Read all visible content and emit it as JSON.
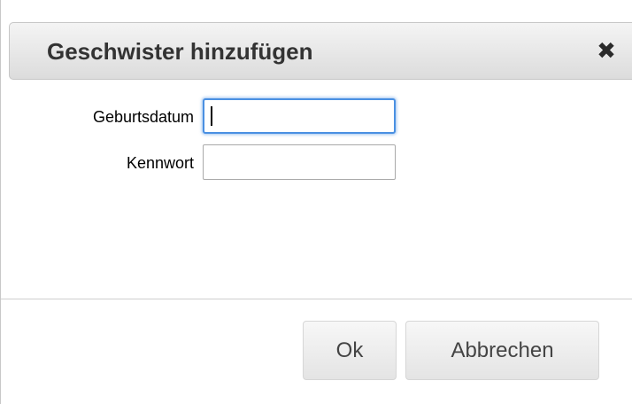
{
  "dialog": {
    "title": "Geschwister hinzufügen",
    "close_glyph": "✖"
  },
  "form": {
    "birthdate": {
      "label": "Geburtsdatum",
      "value": "",
      "focused": true
    },
    "password": {
      "label": "Kennwort",
      "value": ""
    }
  },
  "buttons": {
    "ok_label": "Ok",
    "cancel_label": "Abbrechen"
  },
  "colors": {
    "focus_ring": "#4a90e2",
    "title_text": "#333333",
    "button_text": "#444444"
  }
}
